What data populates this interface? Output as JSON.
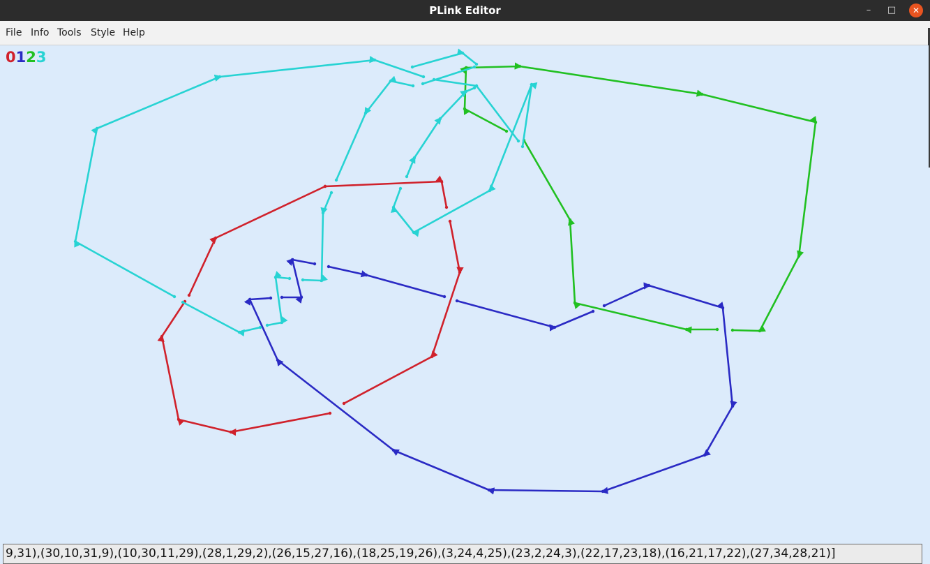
{
  "window": {
    "title": "PLink Editor",
    "minimize_glyph": "–",
    "maximize_glyph": "□",
    "close_glyph": "✕"
  },
  "menu": [
    "File",
    "Info",
    "Tools",
    "Style",
    "Help"
  ],
  "components": [
    {
      "label": "0",
      "color": "#d0212b"
    },
    {
      "label": "1",
      "color": "#2a2ac4"
    },
    {
      "label": "2",
      "color": "#21c021"
    },
    {
      "label": "3",
      "color": "#27d3d3"
    }
  ],
  "status_text": "9,31),(30,10,31,9),(10,30,11,29),(28,1,29,2),(26,15,27,16),(18,25,19,26),(3,24,4,25),(23,2,24,3),(22,17,23,18),(16,21,17,22),(27,34,28,21)]"
}
